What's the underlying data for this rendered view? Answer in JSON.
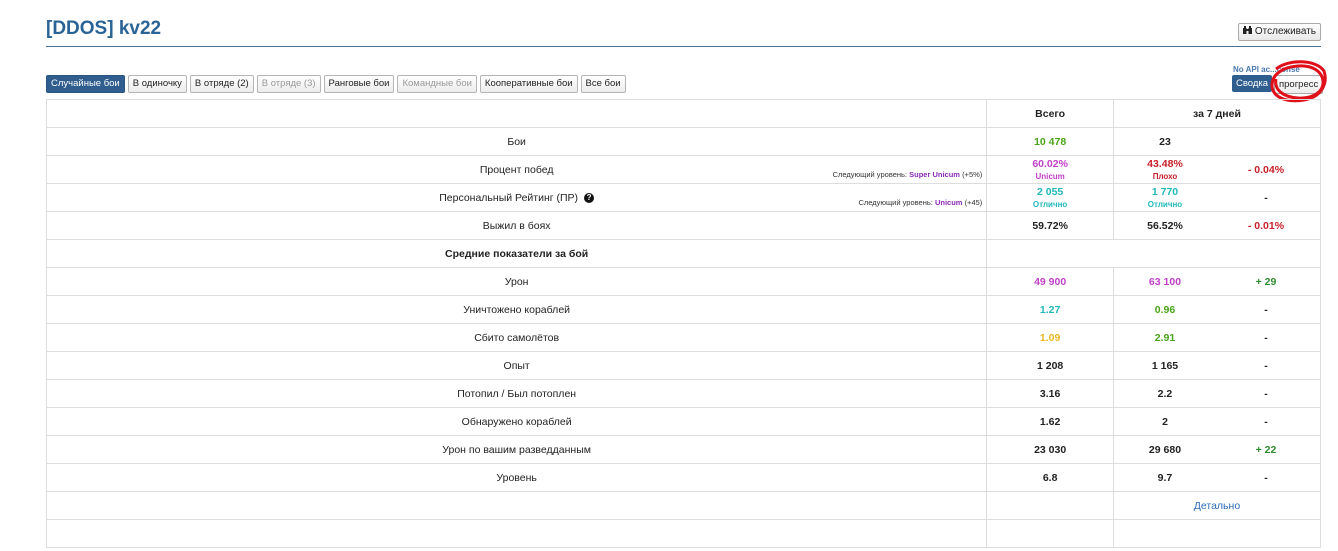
{
  "header": {
    "title": "[DDOS] kv22",
    "track_label": "Отслеживать"
  },
  "tabs": [
    {
      "label": "Случайные бои",
      "state": "active"
    },
    {
      "label": "В одиночку",
      "state": "normal"
    },
    {
      "label": "В отряде (2)",
      "state": "normal"
    },
    {
      "label": "В отряде (3)",
      "state": "disabled"
    },
    {
      "label": "Ранговые бои",
      "state": "normal"
    },
    {
      "label": "Командные бои",
      "state": "disabled"
    },
    {
      "label": "Кооперативные бои",
      "state": "normal"
    },
    {
      "label": "Все бои",
      "state": "normal"
    }
  ],
  "right_controls": {
    "api_note": "No API ac...conse",
    "svodka": "Сводка",
    "progress": "прогресс"
  },
  "table": {
    "head_total": "Всего",
    "head_week": "за 7 дней",
    "rows": {
      "battles": {
        "label": "Бои",
        "total": "10 478",
        "week": "23",
        "delta": ""
      },
      "winrate": {
        "label": "Процент побед",
        "total": "60.02%",
        "total_sub": "Unicum",
        "week": "43.48%",
        "week_sub": "Плохо",
        "delta": "- 0.04%",
        "next_prefix": "Следующий уровень:",
        "next_level": "Super Unicum",
        "next_suffix": "(+5%)"
      },
      "pr": {
        "label": "Персональный Рейтинг (ПР)",
        "total": "2 055",
        "total_sub": "Отлично",
        "week": "1 770",
        "week_sub": "Отлично",
        "delta": "-",
        "next_prefix": "Следующий уровень:",
        "next_level": "Unicum",
        "next_suffix": "(+45)"
      },
      "survived": {
        "label": "Выжил в боях",
        "total": "59.72%",
        "week": "56.52%",
        "delta": "- 0.01%"
      },
      "section": {
        "label": "Средние показатели за бой"
      },
      "damage": {
        "label": "Урон",
        "total": "49 900",
        "week": "63 100",
        "delta": "+ 29"
      },
      "kills": {
        "label": "Уничтожено кораблей",
        "total": "1.27",
        "week": "0.96",
        "delta": "-"
      },
      "planes": {
        "label": "Сбито самолётов",
        "total": "1.09",
        "week": "2.91",
        "delta": "-"
      },
      "xp": {
        "label": "Опыт",
        "total": "1 208",
        "week": "1 165",
        "delta": "-"
      },
      "kd": {
        "label": "Потопил / Был потоплен",
        "total": "3.16",
        "week": "2.2",
        "delta": "-"
      },
      "spotted": {
        "label": "Обнаружено кораблей",
        "total": "1.62",
        "week": "2",
        "delta": "-"
      },
      "scout": {
        "label": "Урон по вашим разведданным",
        "total": "23 030",
        "week": "29 680",
        "delta": "+ 22"
      },
      "tier": {
        "label": "Уровень",
        "total": "6.8",
        "week": "9.7",
        "delta": "-"
      },
      "details": {
        "link": "Детально"
      }
    }
  },
  "colors": {
    "accent": "#2f5e8e",
    "green": "#4aa417",
    "purple": "#c040c8",
    "red": "#c8202a",
    "cyan": "#20b8b8",
    "yellow": "#e8b820"
  },
  "icons": {
    "track": "binoculars-icon",
    "help": "question-circle-icon"
  }
}
